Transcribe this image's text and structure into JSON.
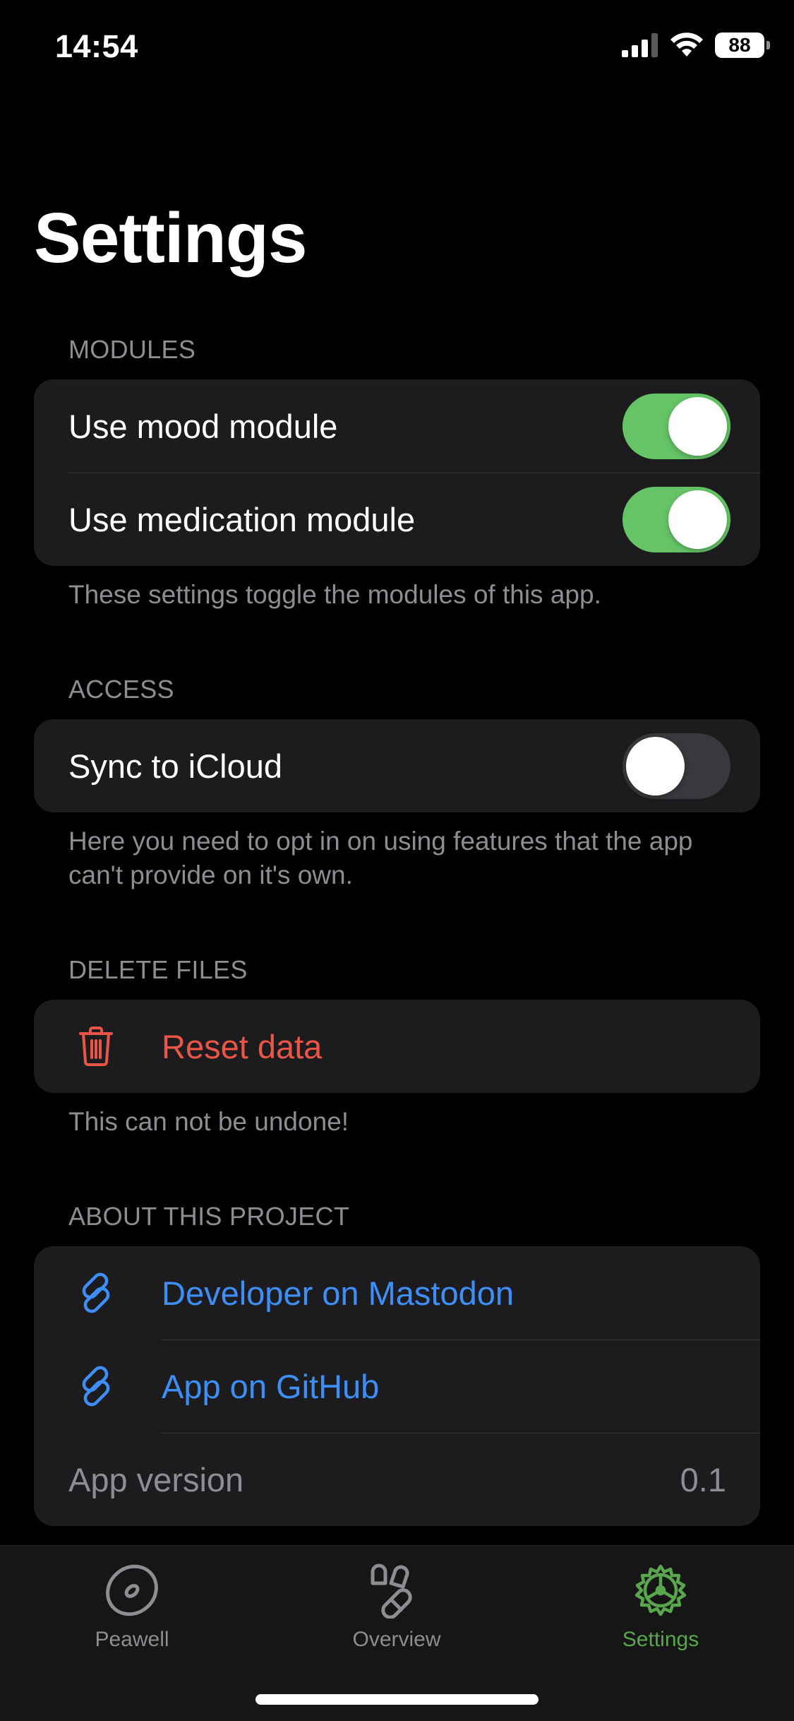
{
  "status_bar": {
    "time": "14:54",
    "battery": "88"
  },
  "page": {
    "title": "Settings"
  },
  "sections": {
    "modules": {
      "header": "MODULES",
      "rows": [
        {
          "label": "Use mood module",
          "toggle": true
        },
        {
          "label": "Use medication module",
          "toggle": true
        }
      ],
      "footer": "These settings toggle the modules of this app."
    },
    "access": {
      "header": "ACCESS",
      "rows": [
        {
          "label": "Sync to iCloud",
          "toggle": false
        }
      ],
      "footer": "Here you need to opt in on using features that the app can't provide on it's own."
    },
    "delete": {
      "header": "DELETE FILES",
      "rows": [
        {
          "label": "Reset data",
          "icon": "trash-icon"
        }
      ],
      "footer": "This can not be undone!"
    },
    "about": {
      "header": "ABOUT THIS PROJECT",
      "rows": [
        {
          "label": "Developer on Mastodon",
          "icon": "link-icon"
        },
        {
          "label": "App on GitHub",
          "icon": "link-icon"
        },
        {
          "label": "App version",
          "value": "0.1"
        }
      ]
    }
  },
  "tab_bar": {
    "tabs": [
      {
        "label": "Peawell",
        "icon": "pea-icon",
        "active": false
      },
      {
        "label": "Overview",
        "icon": "pills-icon",
        "active": false
      },
      {
        "label": "Settings",
        "icon": "gear-icon",
        "active": true
      }
    ]
  },
  "colors": {
    "background": "#000000",
    "group_background": "#1c1c1e",
    "toggle_on": "#65c466",
    "destructive": "#eb5545",
    "link": "#3e8ef7",
    "tab_active": "#5aa64f",
    "secondary_text": "#8d8d93"
  }
}
